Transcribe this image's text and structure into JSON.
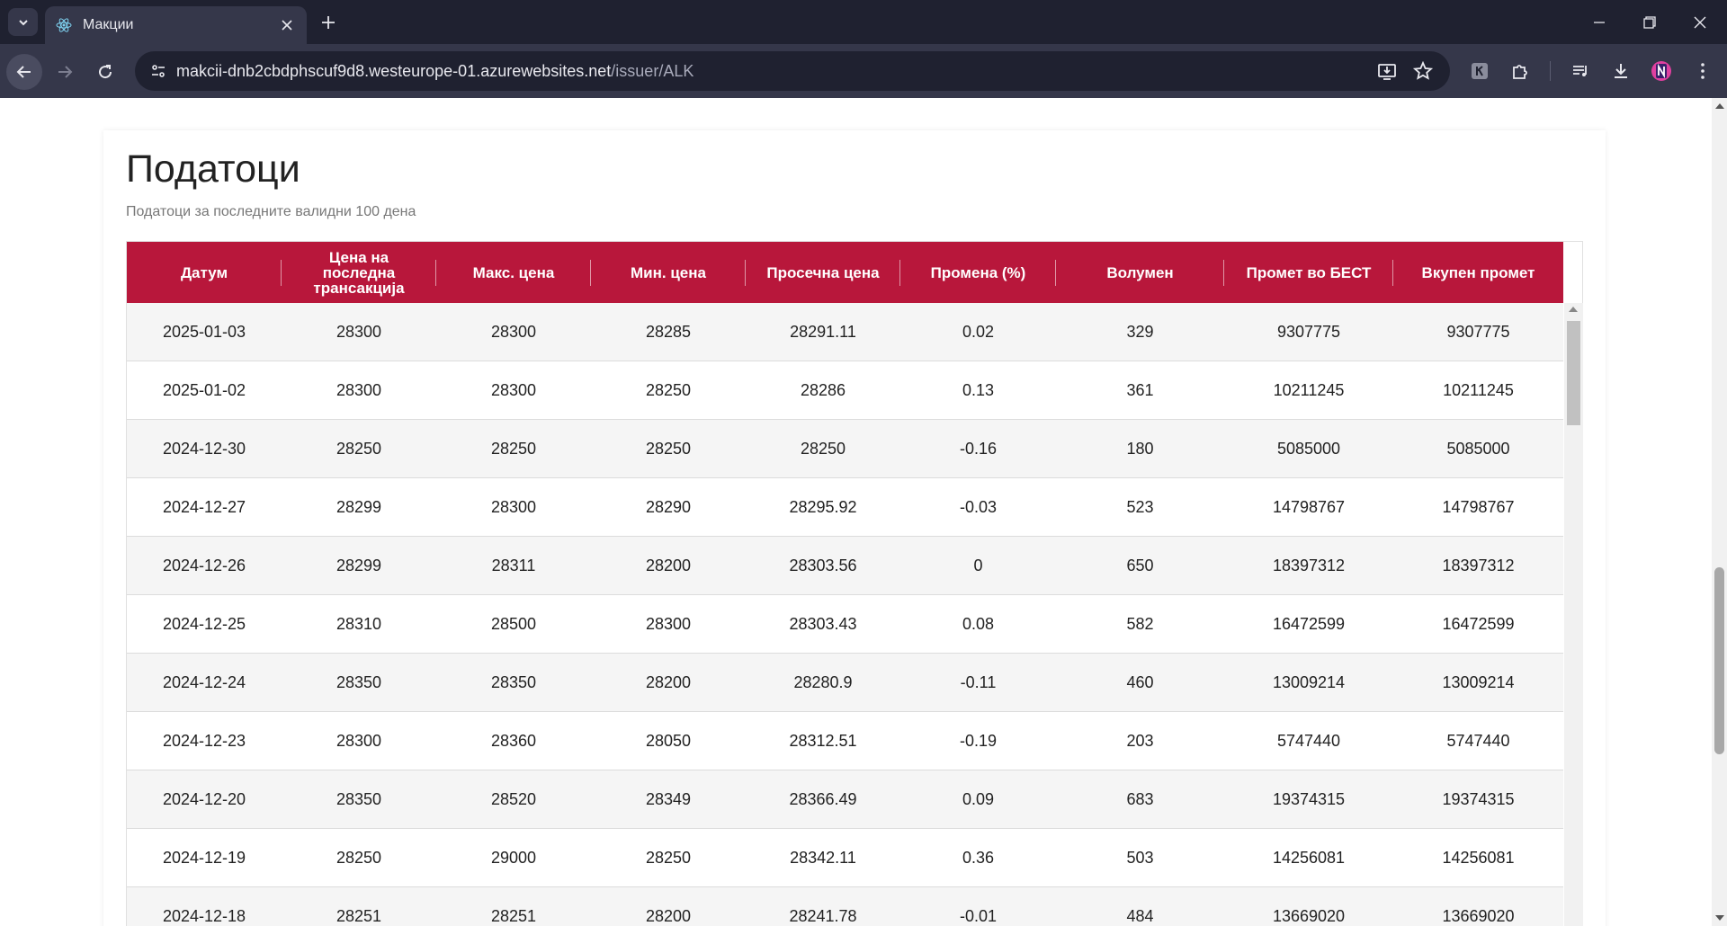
{
  "browser": {
    "tab_title": "Макции",
    "url_host": "makcii-dnb2cbdphscuf9d8.westeurope-01.azurewebsites.net",
    "url_path": "/issuer/ALK"
  },
  "page": {
    "title": "Податоци",
    "subtitle": "Податоци за последните валидни 100 дена"
  },
  "table": {
    "headers": [
      "Датум",
      "Цена на последна трансакција",
      "Макс. цена",
      "Мин. цена",
      "Просечна цена",
      "Промена (%)",
      "Волумен",
      "Промет во БЕСТ",
      "Вкупен промет"
    ],
    "rows": [
      [
        "2025-01-03",
        "28300",
        "28300",
        "28285",
        "28291.11",
        "0.02",
        "329",
        "9307775",
        "9307775"
      ],
      [
        "2025-01-02",
        "28300",
        "28300",
        "28250",
        "28286",
        "0.13",
        "361",
        "10211245",
        "10211245"
      ],
      [
        "2024-12-30",
        "28250",
        "28250",
        "28250",
        "28250",
        "-0.16",
        "180",
        "5085000",
        "5085000"
      ],
      [
        "2024-12-27",
        "28299",
        "28300",
        "28290",
        "28295.92",
        "-0.03",
        "523",
        "14798767",
        "14798767"
      ],
      [
        "2024-12-26",
        "28299",
        "28311",
        "28200",
        "28303.56",
        "0",
        "650",
        "18397312",
        "18397312"
      ],
      [
        "2024-12-25",
        "28310",
        "28500",
        "28300",
        "28303.43",
        "0.08",
        "582",
        "16472599",
        "16472599"
      ],
      [
        "2024-12-24",
        "28350",
        "28350",
        "28200",
        "28280.9",
        "-0.11",
        "460",
        "13009214",
        "13009214"
      ],
      [
        "2024-12-23",
        "28300",
        "28360",
        "28050",
        "28312.51",
        "-0.19",
        "203",
        "5747440",
        "5747440"
      ],
      [
        "2024-12-20",
        "28350",
        "28520",
        "28349",
        "28366.49",
        "0.09",
        "683",
        "19374315",
        "19374315"
      ],
      [
        "2024-12-19",
        "28250",
        "29000",
        "28250",
        "28342.11",
        "0.36",
        "503",
        "14256081",
        "14256081"
      ],
      [
        "2024-12-18",
        "28251",
        "28251",
        "28200",
        "28241.78",
        "-0.01",
        "484",
        "13669020",
        "13669020"
      ]
    ]
  }
}
